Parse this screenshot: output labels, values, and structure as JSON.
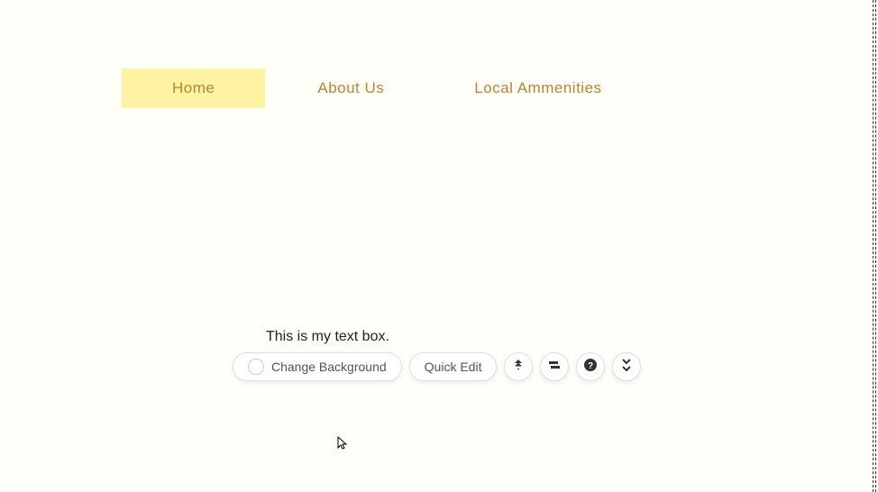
{
  "nav": {
    "items": [
      {
        "label": "Home",
        "active": true
      },
      {
        "label": "About Us",
        "active": false
      },
      {
        "label": "Local Ammenities",
        "active": false
      }
    ]
  },
  "textbox": {
    "content": "This is my text box."
  },
  "toolbar": {
    "change_bg_label": "Change Background",
    "quick_edit_label": "Quick Edit"
  }
}
